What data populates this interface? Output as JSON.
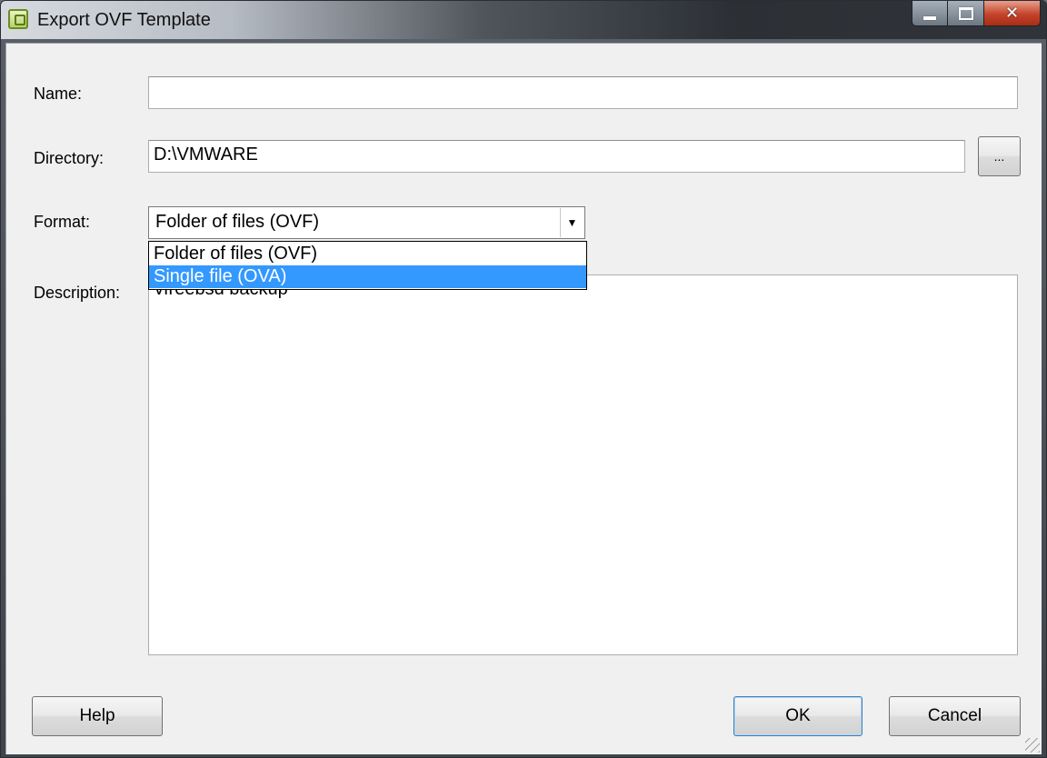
{
  "window": {
    "title": "Export OVF Template",
    "controls": {
      "minimize": "minimize",
      "maximize": "maximize",
      "close": "close"
    }
  },
  "form": {
    "name_label": "Name:",
    "name_value": "",
    "directory_label": "Directory:",
    "directory_value": "D:\\VMWARE",
    "browse_label": "...",
    "format_label": "Format:",
    "format_selected": "Folder of files (OVF)",
    "format_options": [
      "Folder of files (OVF)",
      "Single file (OVA)"
    ],
    "format_highlighted_index": 1,
    "description_label": "Description:",
    "description_value": "vfreebsd backup"
  },
  "buttons": {
    "help": "Help",
    "ok": "OK",
    "cancel": "Cancel"
  },
  "colors": {
    "highlight": "#3399ff",
    "dialog_bg": "#f0f0f0"
  },
  "icons": {
    "app": "vsphere-icon",
    "arrow": "chevron-down-icon"
  }
}
